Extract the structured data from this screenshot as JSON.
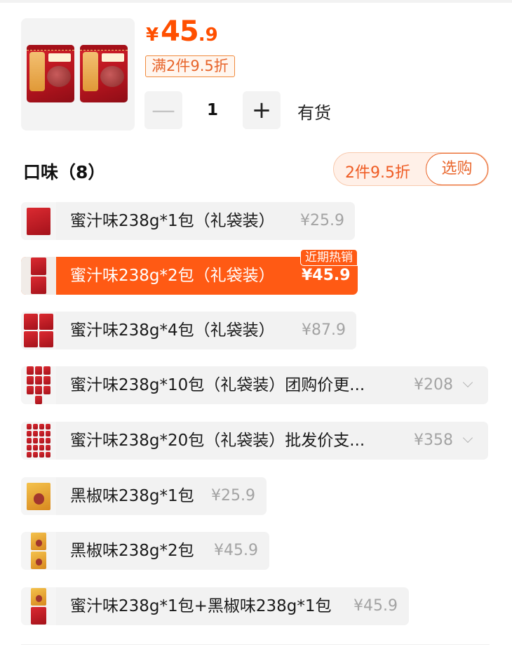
{
  "product": {
    "price_symbol": "¥",
    "price_int": "45",
    "price_dec": ".9",
    "promo_chip": "满2件9.5折",
    "quantity": "1",
    "minus_glyph": "—",
    "plus_glyph": "+",
    "stock": "有货"
  },
  "section": {
    "title": "口味（8）",
    "discount": "2件9.5折",
    "select_label": "选购"
  },
  "options": [
    {
      "name": "蜜汁味238g*1包（礼袋装）",
      "price": "¥25.9",
      "packs": 1,
      "style": "red",
      "selected": false
    },
    {
      "name": "蜜汁味238g*2包（礼袋装）",
      "price": "¥45.9",
      "packs": 2,
      "style": "red",
      "selected": true,
      "badge": "近期热销"
    },
    {
      "name": "蜜汁味238g*4包（礼袋装）",
      "price": "¥87.9",
      "packs": 4,
      "style": "red",
      "selected": false
    },
    {
      "name": "蜜汁味238g*10包（礼袋装）团购价更...",
      "price": "¥208",
      "packs": 10,
      "style": "red",
      "selected": false,
      "expandable": true
    },
    {
      "name": "蜜汁味238g*20包（礼袋装）批发价支...",
      "price": "¥358",
      "packs": 20,
      "style": "red",
      "selected": false,
      "expandable": true
    },
    {
      "name": "黑椒味238g*1包",
      "price": "¥25.9",
      "packs": 1,
      "style": "gold",
      "selected": false
    },
    {
      "name": "黑椒味238g*2包",
      "price": "¥45.9",
      "packs": 2,
      "style": "gold",
      "selected": false
    },
    {
      "name": "蜜汁味238g*1包+黑椒味238g*1包",
      "price": "¥45.9",
      "packs": 2,
      "style": "mixed",
      "selected": false
    }
  ],
  "colors": {
    "accent": "#ff5a14",
    "price": "#ff4f00",
    "chip_border": "#f08a3c",
    "muted_price": "#a3a3a3"
  },
  "icons": {
    "minus": "minus-icon",
    "plus": "plus-icon",
    "chevron": "chevron-down-icon"
  }
}
